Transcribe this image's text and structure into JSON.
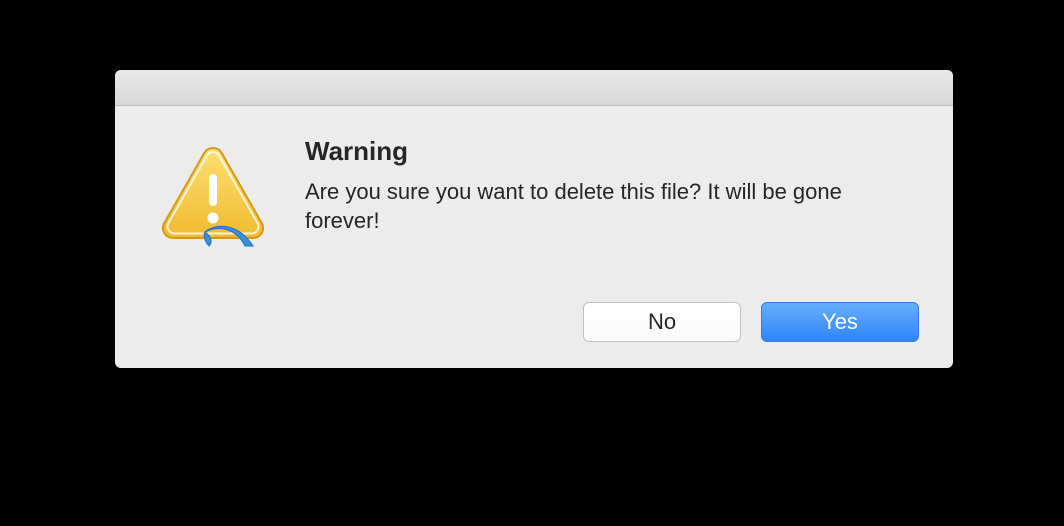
{
  "dialog": {
    "title": "Warning",
    "message": "Are you sure you want to delete this file? It will be gone forever!",
    "buttons": {
      "no_label": "No",
      "yes_label": "Yes"
    }
  }
}
